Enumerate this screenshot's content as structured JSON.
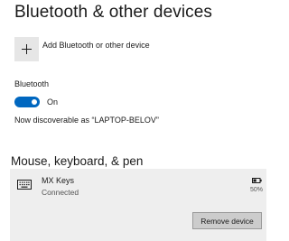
{
  "page": {
    "title": "Bluetooth & other devices"
  },
  "add_device": {
    "icon": "plus-icon",
    "label": "Add Bluetooth or other device"
  },
  "bluetooth": {
    "label": "Bluetooth",
    "toggle_on": true,
    "toggle_state_label": "On",
    "discoverable_text": "Now discoverable as “LAPTOP-BELOV”"
  },
  "section": {
    "title": "Mouse, keyboard, & pen"
  },
  "device": {
    "icon": "keyboard-icon",
    "name": "MX Keys",
    "status": "Connected",
    "battery_icon": "battery-icon",
    "battery_percent": "50%",
    "battery_level": 0.5,
    "remove_label": "Remove device"
  },
  "colors": {
    "accent": "#0067c0",
    "card_background": "#eeeeee",
    "add_tile_background": "#e6e6e6",
    "button_background": "#cccccc"
  }
}
